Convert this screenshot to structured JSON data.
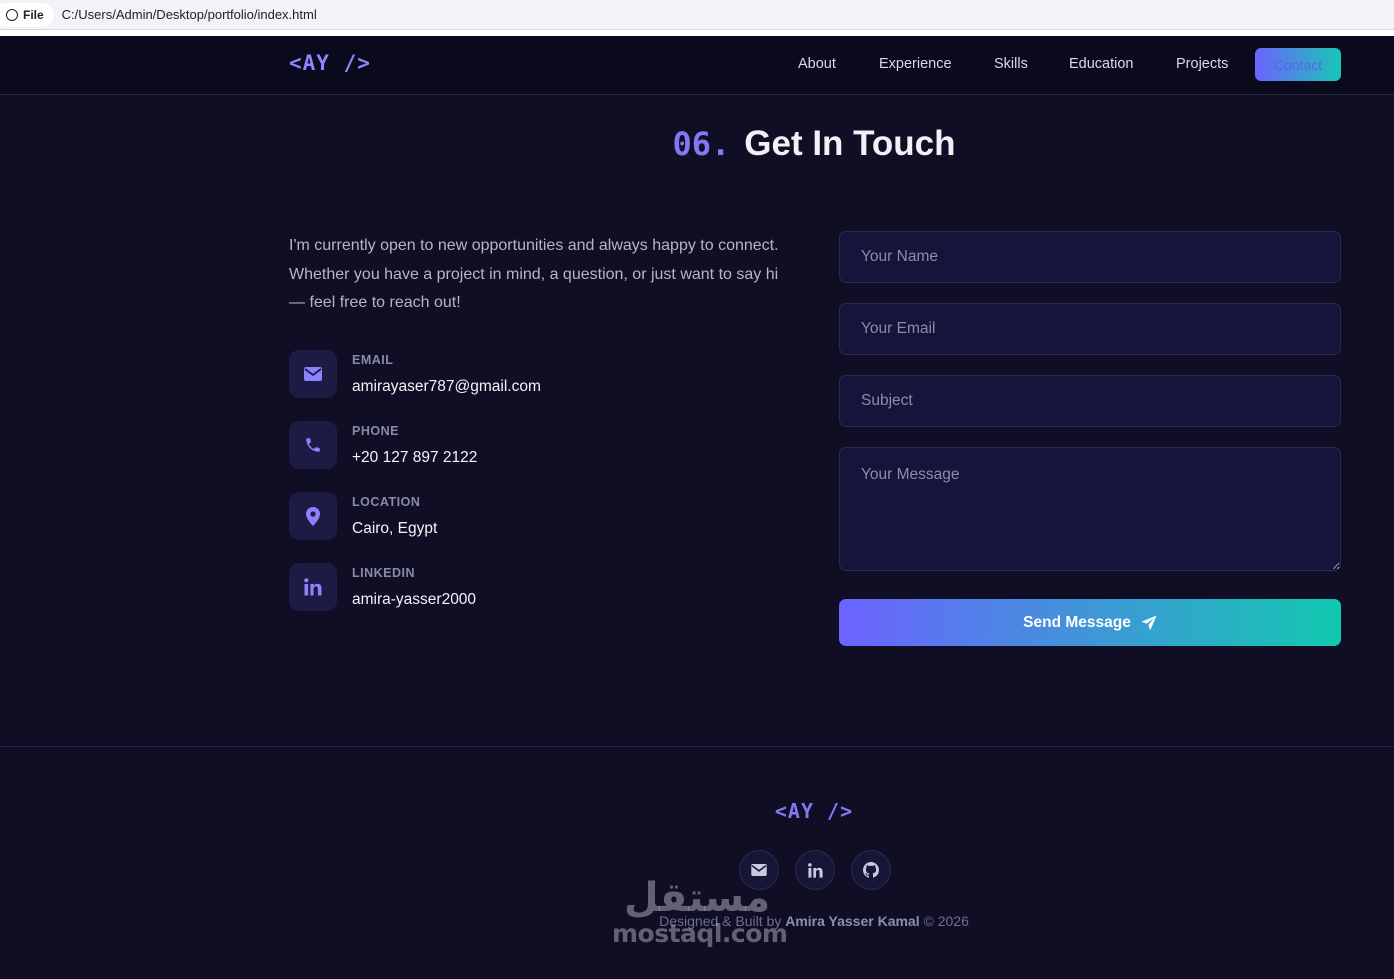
{
  "browser": {
    "scheme_label": "File",
    "url": "C:/Users/Admin/Desktop/portfolio/index.html"
  },
  "nav": {
    "logo": "<AY />",
    "links": [
      "About",
      "Experience",
      "Skills",
      "Education",
      "Projects"
    ],
    "contact_label": "Contact"
  },
  "section": {
    "number": "06.",
    "title": "Get In Touch"
  },
  "intro": "I'm currently open to new opportunities and always happy to connect. Whether you have a project in mind, a question, or just want to say hi — feel free to reach out!",
  "contact_info": [
    {
      "label": "EMAIL",
      "value": "amirayaser787@gmail.com",
      "icon": "envelope-icon"
    },
    {
      "label": "PHONE",
      "value": "+20 127 897 2122",
      "icon": "phone-icon"
    },
    {
      "label": "LOCATION",
      "value": "Cairo, Egypt",
      "icon": "map-pin-icon"
    },
    {
      "label": "LINKEDIN",
      "value": "amira-yasser2000",
      "icon": "linkedin-icon"
    }
  ],
  "form": {
    "name_placeholder": "Your Name",
    "email_placeholder": "Your Email",
    "subject_placeholder": "Subject",
    "message_placeholder": "Your Message",
    "send_label": "Send Message"
  },
  "footer": {
    "logo": "<AY />",
    "social": [
      "envelope-icon",
      "linkedin-icon",
      "github-icon"
    ],
    "credit_prefix": "Designed & Built by",
    "credit_name": "Amira Yasser Kamal",
    "credit_suffix": "© 2026"
  },
  "watermark": {
    "arabic": "مستقل",
    "latin": "mostaql.com"
  },
  "colors": {
    "background": "#100e24",
    "accent": "#8178f5",
    "teal": "#12c9b0"
  }
}
